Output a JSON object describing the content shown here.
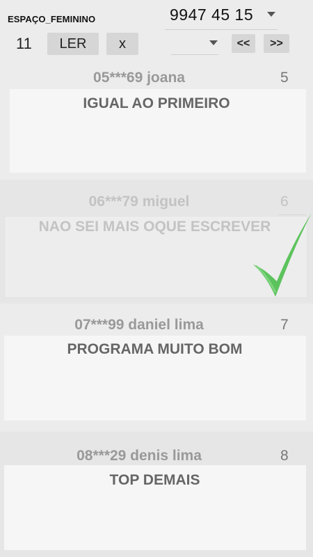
{
  "header": {
    "channel": "ESPAÇO_FEMININO",
    "count": "11",
    "read_button": "LER",
    "clear_button": "x",
    "phone_selected": "9947 45 15",
    "secondary_selected": "",
    "prev_button": "<<",
    "next_button": ">>"
  },
  "messages": [
    {
      "meta": "05***69 joana",
      "index": "5",
      "text": "IGUAL AO PRIMEIRO",
      "read": false
    },
    {
      "meta": "06***79 miguel",
      "index": "6",
      "text": "NAO SEI MAIS OQUE ESCREVER",
      "read": true
    },
    {
      "meta": "07***99 daniel lima",
      "index": "7",
      "text": "PROGRAMA MUITO BOM",
      "read": false
    },
    {
      "meta": "08***29 denis lima",
      "index": "8",
      "text": "TOP DEMAIS",
      "read": false
    }
  ],
  "icons": {
    "read_mark": "green-check-icon"
  },
  "colors": {
    "check": "#5cc35c",
    "background": "#ececec"
  }
}
